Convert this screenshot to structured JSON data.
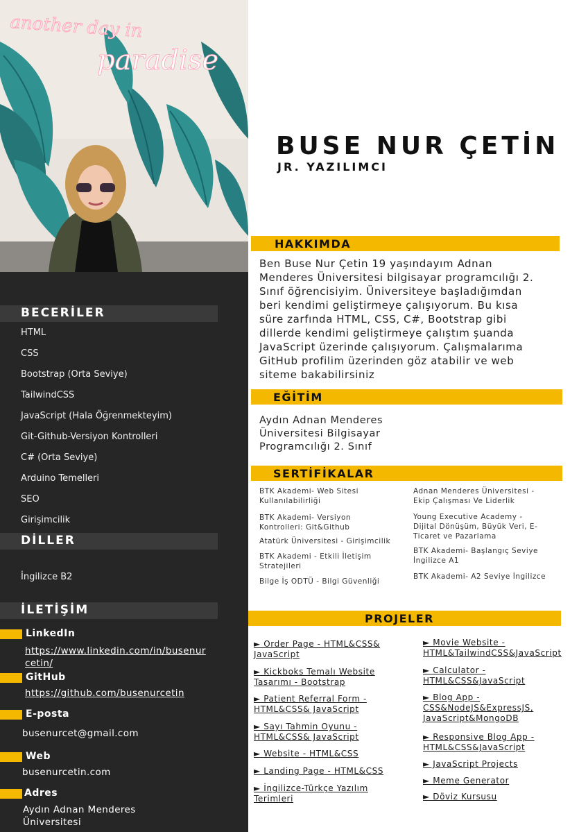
{
  "header": {
    "name": "BUSE NUR ÇETİN",
    "title": "JR. YAZILIMCI"
  },
  "photo": {
    "neon_line1": "another day in",
    "neon_line2": "paradise"
  },
  "skills": {
    "heading": "BECERİLER",
    "items": [
      "HTML",
      "CSS",
      "Bootstrap (Orta Seviye)",
      "TailwindCSS",
      "JavaScript (Hala Öğrenmekteyim)",
      "Git-Github-Versiyon Kontrolleri",
      "C# (Orta Seviye)",
      "Arduino Temelleri",
      "SEO",
      "Girişimcilik"
    ]
  },
  "languages": {
    "heading": "DİLLER",
    "items": [
      "İngilizce B2"
    ]
  },
  "contact": {
    "heading": "İLETİŞİM",
    "linkedin_label": "LinkedIn",
    "linkedin_line1": "https://www.linkedin.com/in/busenur",
    "linkedin_line2": "cetin/",
    "github_label": "GitHub",
    "github_value": "https://github.com/busenurcetin",
    "email_label": "E-posta",
    "email_value": "busenurcet@gmail.com",
    "web_label": "Web",
    "web_value": "busenurcetin.com",
    "address_label": "Adres",
    "address_line1": "Aydın Adnan Menderes",
    "address_line2": "Üniversitesi"
  },
  "about": {
    "heading": "HAKKIMDA",
    "lines": [
      "Ben Buse Nur Çetin 19 yaşındayım Adnan",
      "Menderes Üniversitesi bilgisayar programcılığı 2.",
      "Sınıf öğrencisiyim. Üniversiteye başladığımdan",
      "beri kendimi geliştirmeye çalışıyorum. Bu kısa",
      "süre zarfında HTML, CSS, C#, Bootstrap gibi",
      "dillerde kendimi geliştirmeye çalıştım şuanda",
      "JavaScript üzerinde çalışıyorum. Çalışmalarıma",
      "GitHub profilim üzerinden göz atabilir ve web",
      "siteme bakabilirsiniz"
    ]
  },
  "education": {
    "heading": "EĞİTİM",
    "lines": [
      "Aydın Adnan Menderes",
      "Üniversitesi Bilgisayar",
      "Programcılığı 2. Sınıf"
    ]
  },
  "certificates": {
    "heading": "SERTİFİKALAR",
    "left": [
      [
        "BTK Akademi- Web Sitesi",
        "Kullanılabilirliği"
      ],
      [
        "BTK Akademi- Versiyon",
        "Kontrolleri: Git&Github"
      ],
      [
        "Atatürk Üniversitesi - Girişimcilik"
      ],
      [
        "BTK Akademi - Etkili İletişim",
        "Stratejileri"
      ],
      [
        "Bilge İş ODTÜ - Bilgi Güvenliği"
      ]
    ],
    "right": [
      [
        "Adnan Menderes Üniversitesi -",
        "Ekip Çalışması Ve Liderlik"
      ],
      [
        "Young Executive Academy -",
        "Dijital Dönüşüm, Büyük Veri, E-",
        "Ticaret ve Pazarlama"
      ],
      [
        "BTK Akademi- Başlangıç Seviye",
        "İngilizce A1"
      ],
      [
        "BTK Akademi-  A2 Seviye İngilizce"
      ]
    ]
  },
  "projects": {
    "heading": "PROJELER",
    "left": [
      [
        "► Order Page - HTML&CSS&",
        "JavaScript "
      ],
      [
        "► Kickboks Temalı Website",
        "Tasarımı - Bootstrap "
      ],
      [
        "► Patient Referral Form -",
        "HTML&CSS& JavaScript "
      ],
      [
        "► Sayı Tahmin Oyunu -",
        "HTML&CSS& JavaScript "
      ],
      [
        "► Website - HTML&CSS "
      ],
      [
        "► Landing Page - HTML&CSS "
      ],
      [
        "► İngilizce-Türkçe Yazılım",
        "Terimleri"
      ]
    ],
    "right": [
      [
        "► Movie Website -",
        "HTML&TailwindCSS&JavaScript "
      ],
      [
        "► Calculator -",
        "HTML&CSS&JavaScript "
      ],
      [
        "► Blog App -",
        "CSS&NodeJS&ExpressJS,",
        "JavaScript&MongoDB"
      ],
      [
        "► Responsive Blog App -",
        "HTML&CSS&JavaScript "
      ],
      [
        "► JavaScript Projects"
      ],
      [
        "► Meme Generator"
      ],
      [
        "► Döviz Kursusu"
      ]
    ]
  },
  "colors": {
    "accent": "#f5b800",
    "sidebar": "#262626",
    "sidebar_heading": "#3a3a3a",
    "neon": "#ffdfe6"
  }
}
